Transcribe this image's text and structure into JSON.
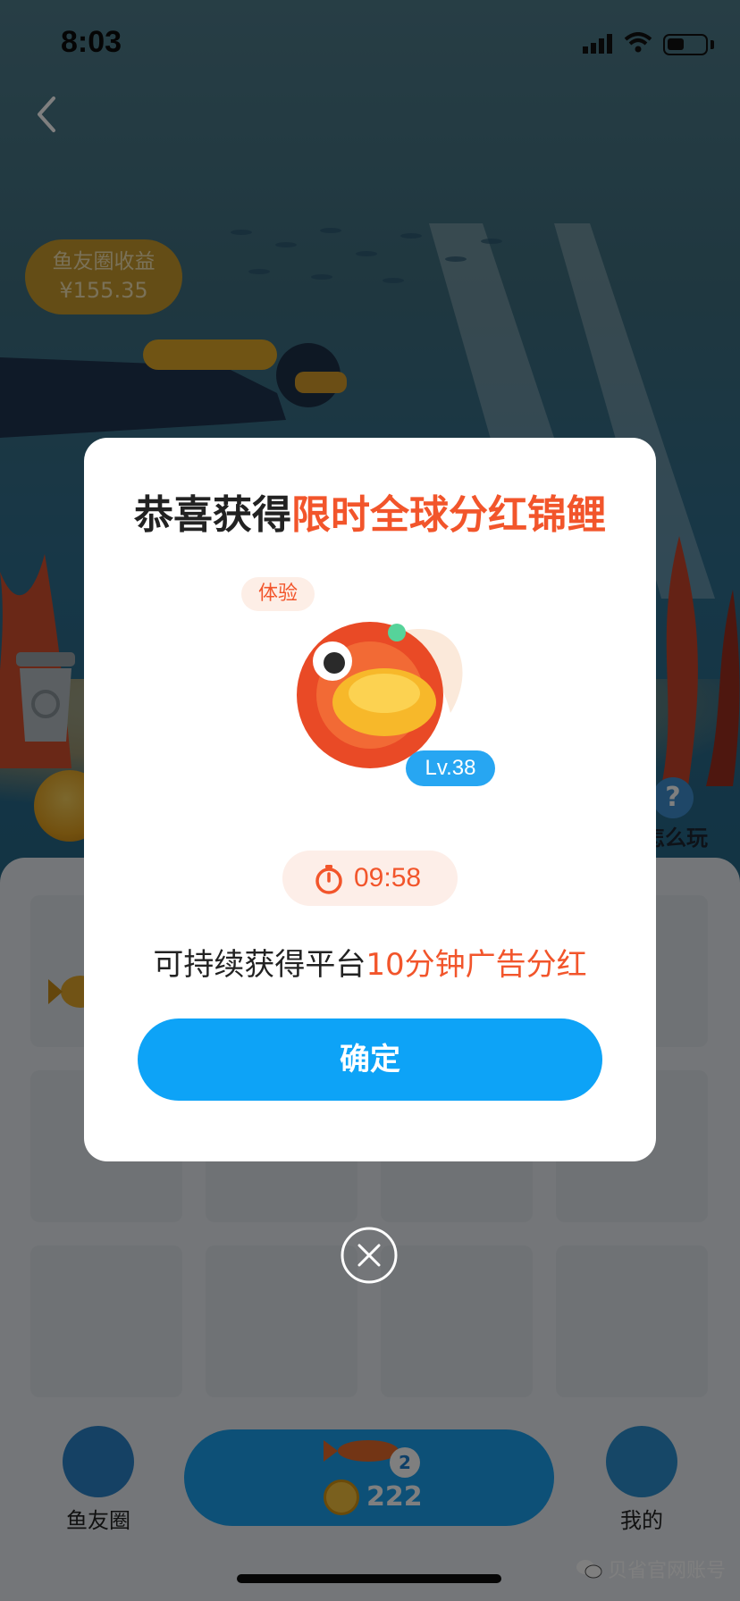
{
  "status_bar": {
    "time": "8:03"
  },
  "background": {
    "earnings": {
      "label": "鱼友圈收益",
      "amount": "¥155.35"
    },
    "help_label": "怎么玩",
    "bottom_nav": {
      "left_label": "鱼友圈",
      "right_label": "我的",
      "center_badge": "2",
      "center_coins": "222"
    },
    "watermark": "贝省官网账号"
  },
  "modal": {
    "title_prefix": "恭喜获得",
    "title_highlight": "限时全球分红锦鲤",
    "tag": "体验",
    "level": "Lv.38",
    "timer": "09:58",
    "desc_prefix": "可持续获得平台",
    "desc_highlight": "10分钟广告分红",
    "confirm_label": "确定"
  },
  "colors": {
    "accent_red": "#f2552b",
    "primary_blue": "#0da3f7"
  }
}
